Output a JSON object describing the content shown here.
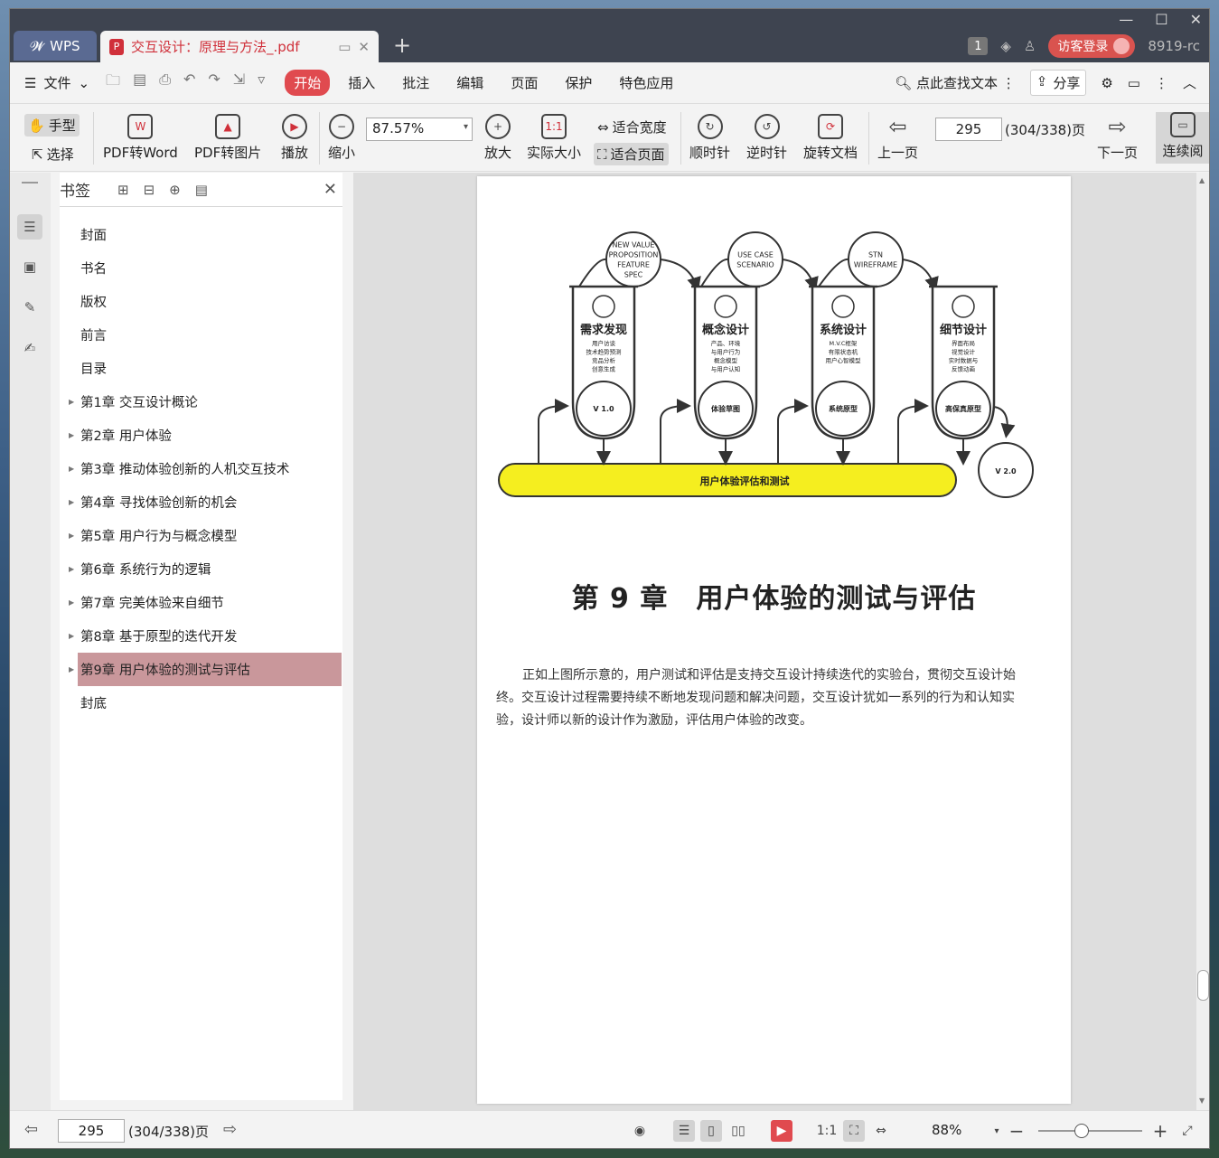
{
  "window": {
    "app_tab": "WPS",
    "doc_tab_title": "交互设计：原理与方法_.pdf",
    "tab_count": "1",
    "guest_login": "访客登录",
    "version": "8919-rc"
  },
  "menu": {
    "file": "文件",
    "items": [
      "开始",
      "插入",
      "批注",
      "编辑",
      "页面",
      "保护",
      "特色应用"
    ],
    "search": "点此查找文本",
    "share": "分享"
  },
  "toolbar": {
    "hand": "手型",
    "select": "选择",
    "pdf_to_word": "PDF转Word",
    "pdf_to_image": "PDF转图片",
    "play": "播放",
    "zoom_out": "缩小",
    "zoom_value": "87.57%",
    "zoom_in": "放大",
    "actual_size": "实际大小",
    "fit_width": "适合宽度",
    "fit_page": "适合页面",
    "clockwise": "顺时针",
    "counterclockwise": "逆时针",
    "rotate_doc": "旋转文档",
    "prev_page": "上一页",
    "page_input": "295",
    "page_total": "(304/338)页",
    "next_page": "下一页",
    "continuous": "连续阅"
  },
  "bookmarks": {
    "title": "书签",
    "items": [
      {
        "label": "封面",
        "expandable": false
      },
      {
        "label": "书名",
        "expandable": false
      },
      {
        "label": "版权",
        "expandable": false
      },
      {
        "label": "前言",
        "expandable": false
      },
      {
        "label": "目录",
        "expandable": false
      },
      {
        "label": "第1章 交互设计概论",
        "expandable": true
      },
      {
        "label": "第2章 用户体验",
        "expandable": true
      },
      {
        "label": "第3章 推动体验创新的人机交互技术",
        "expandable": true
      },
      {
        "label": "第4章 寻找体验创新的机会",
        "expandable": true
      },
      {
        "label": "第5章 用户行为与概念模型",
        "expandable": true
      },
      {
        "label": "第6章 系统行为的逻辑",
        "expandable": true
      },
      {
        "label": "第7章 完美体验来自细节",
        "expandable": true
      },
      {
        "label": "第8章 基于原型的迭代开发",
        "expandable": true
      },
      {
        "label": "第9章 用户体验的测试与评估",
        "expandable": true
      },
      {
        "label": "封底",
        "expandable": false
      }
    ],
    "selected_index": 13
  },
  "page": {
    "diagram": {
      "circles_top": [
        "NEW VALUE\nPROPOSITION\nFEATURE\nSPEC",
        "USE CASE\nSCENARIO",
        "STN\nWIREFRAME"
      ],
      "stages": [
        {
          "title": "需求发现",
          "lines": [
            "用户访谈",
            "技术趋势预测",
            "竞品分析",
            "创意生成"
          ],
          "bottom": "V 1.0"
        },
        {
          "title": "概念设计",
          "lines": [
            "产品、环境",
            "与用户行为",
            "概念模型",
            "与用户认知"
          ],
          "bottom": "体验草图"
        },
        {
          "title": "系统设计",
          "lines": [
            "M.V.C框架",
            "有限状态机",
            "用户心智模型"
          ],
          "bottom": "系统原型"
        },
        {
          "title": "细节设计",
          "lines": [
            "界面布局",
            "视觉设计",
            "实时数据与",
            "反馈动画"
          ],
          "bottom": "高保真原型"
        }
      ],
      "final": "V 2.0",
      "bar_label": "用户体验评估和测试"
    },
    "chapter_title": "第 9 章　用户体验的测试与评估",
    "paragraph": "正如上图所示意的，用户测试和评估是支持交互设计持续迭代的实验台，贯彻交互设计始终。交互设计过程需要持续不断地发现问题和解决问题，交互设计犹如一系列的行为和认知实验，设计师以新的设计作为激励，评估用户体验的改变。"
  },
  "status": {
    "page_input": "295",
    "page_total": "(304/338)页",
    "zoom": "88%"
  },
  "colors": {
    "accent": "#e04a4f",
    "bookmark_selected": "#c9979b",
    "diagram_yellow": "#f5ee1f"
  }
}
